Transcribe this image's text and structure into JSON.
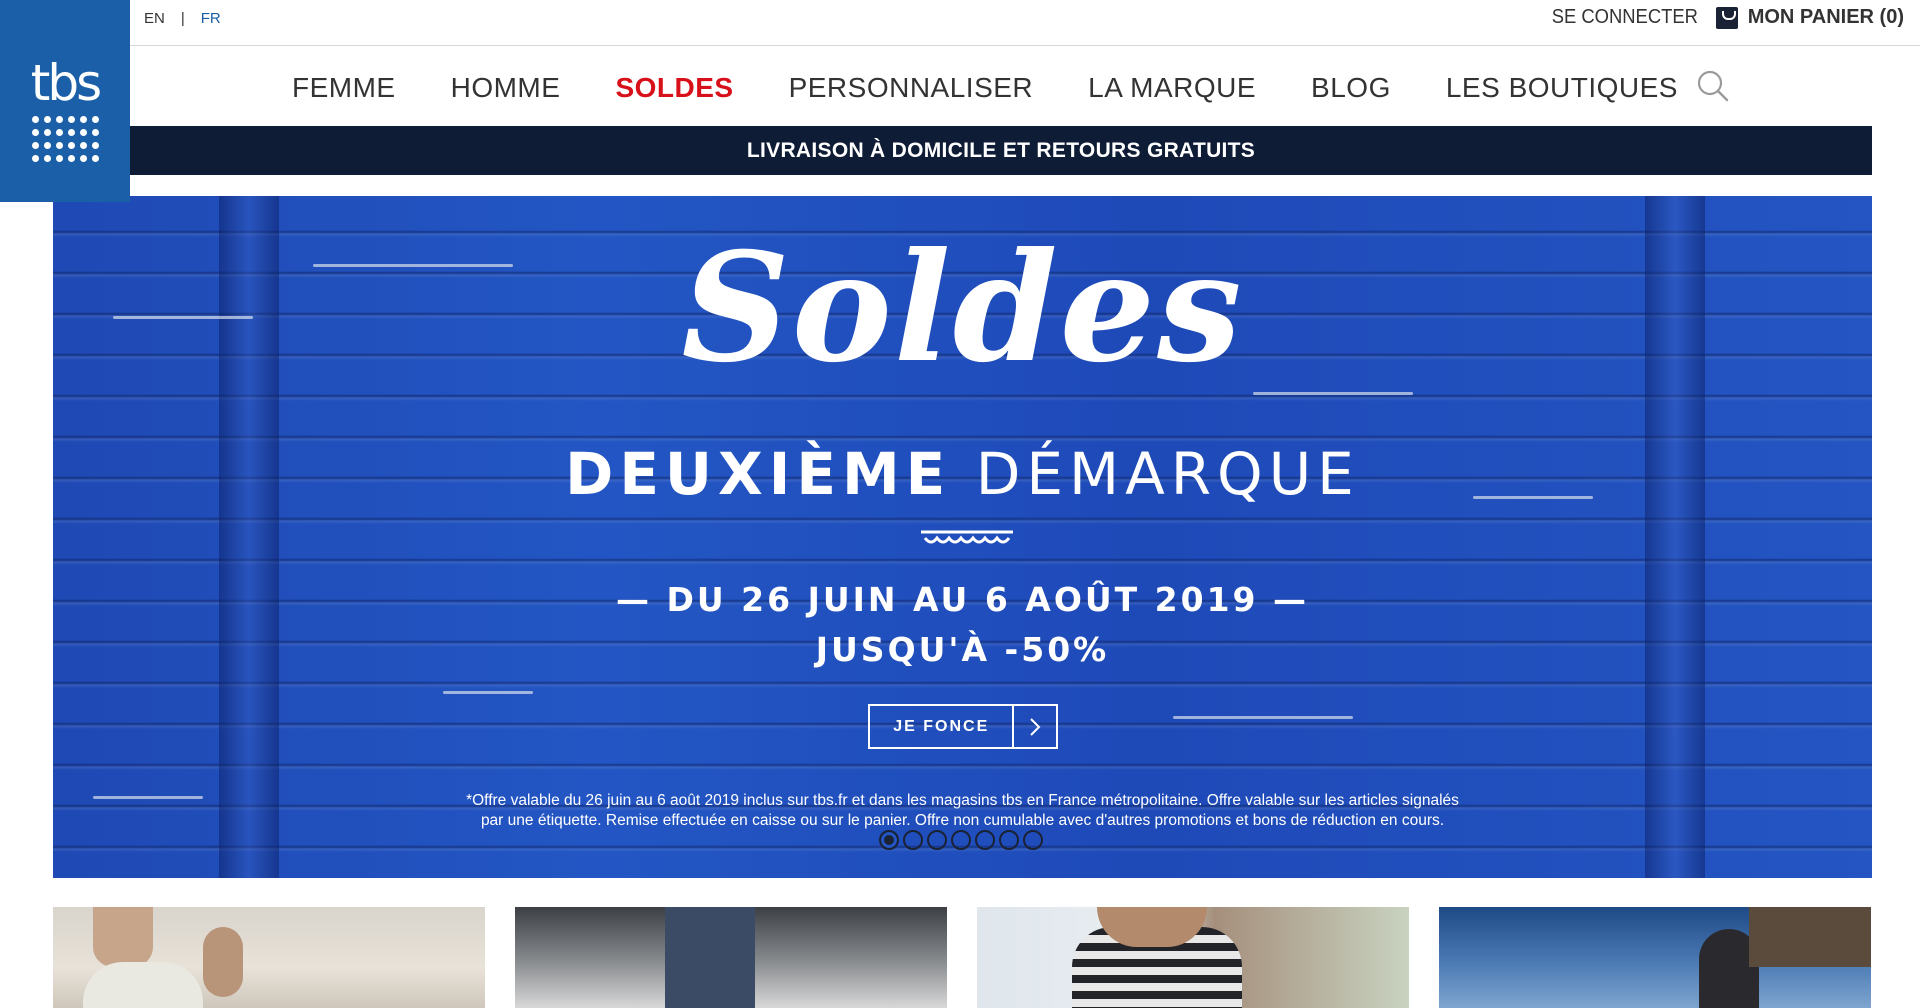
{
  "brand": {
    "logo_text": "tbs",
    "color": "#1b5fa8"
  },
  "topbar": {
    "lang_en": "EN",
    "lang_sep": "|",
    "lang_fr": "FR",
    "login": "SE CONNECTER",
    "cart": "MON PANIER (0)"
  },
  "nav": {
    "items": [
      "FEMME",
      "HOMME",
      "SOLDES",
      "PERSONNALISER",
      "LA MARQUE",
      "BLOG",
      "LES BOUTIQUES"
    ],
    "active_color": "#d8101a"
  },
  "shipping_banner": "LIVRAISON À DOMICILE ET RETOURS GRATUITS",
  "hero": {
    "title": "Soldes",
    "subtitle_bold": "DEUXIÈME",
    "subtitle_light": "DÉMARQUE",
    "dates": "— DU 26 JUIN AU 6 AOÛT 2019 —",
    "discount": "JUSQU'À -50%",
    "cta_label": "JE FONCE",
    "fine_print_line1": "*Offre valable du 26 juin au 6 août 2019 inclus sur tbs.fr et dans les magasins tbs en France métropolitaine. Offre valable sur les articles signalés",
    "fine_print_line2": "par une étiquette. Remise effectuée en caisse ou sur le panier. Offre non cumulable avec d'autres promotions et bons de réduction en cours.",
    "slides_count": 7,
    "active_slide": 1
  },
  "colors": {
    "nav_bar_dark": "#0f1c36",
    "hero_blue": "#2356c4"
  }
}
